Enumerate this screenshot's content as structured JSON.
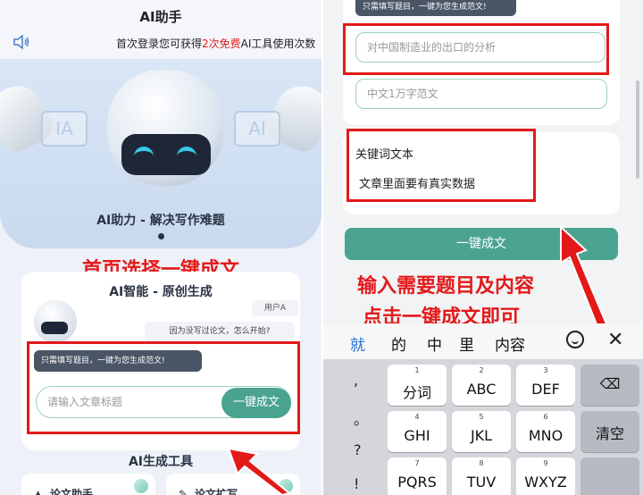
{
  "left": {
    "app_title": "AI助手",
    "notice_prefix": "首次登录您可获得",
    "notice_highlight": "2次免费",
    "notice_suffix": "AI工具使用次数",
    "banner_box_left": "IA",
    "banner_box_right": "AI",
    "banner_caption": "AI助力 - 解决写作难题",
    "red_heading": "首页选择一键成文",
    "card_title": "AI智能 - 原创生成",
    "user_tag": "用户A",
    "question_bubble": "因为没写过论文，怎么开始?",
    "tip_bubble": "只需填写题目，一键为您生成范文!",
    "title_placeholder": "请输入文章标题",
    "generate_button": "一键成文",
    "tools_title": "AI生成工具",
    "tool_1": "论文助手",
    "tool_2": "论文扩写"
  },
  "right": {
    "tip_bubble": "只需填写题目，一键为您生成范文!",
    "topic_value": "对中国制造业的出口的分析",
    "requirement_value": "中文1万字范文",
    "keyword_label": "关键词文本",
    "keyword_value": "文章里面要有真实数据",
    "generate_button": "一键成文",
    "instruction_line1": "输入需要题目及内容",
    "instruction_line2": "点击一键成文即可"
  },
  "keyboard": {
    "candidates": [
      "就",
      "的",
      "中",
      "里",
      "内容"
    ],
    "punctuation": [
      ",",
      "。",
      "?",
      "!"
    ],
    "keys": [
      {
        "num": "1",
        "label": "分词"
      },
      {
        "num": "2",
        "label": "ABC"
      },
      {
        "num": "3",
        "label": "DEF"
      },
      {
        "num": "4",
        "label": "GHI"
      },
      {
        "num": "5",
        "label": "JKL"
      },
      {
        "num": "6",
        "label": "MNO"
      },
      {
        "num": "7",
        "label": "PQRS"
      },
      {
        "num": "8",
        "label": "TUV"
      },
      {
        "num": "9",
        "label": "WXYZ"
      }
    ],
    "clear_label": "清空",
    "backspace_glyph": "⌫"
  },
  "colors": {
    "accent_teal": "#4aa391",
    "annotation_red": "#e31919",
    "highlight_red": "#e02020"
  }
}
